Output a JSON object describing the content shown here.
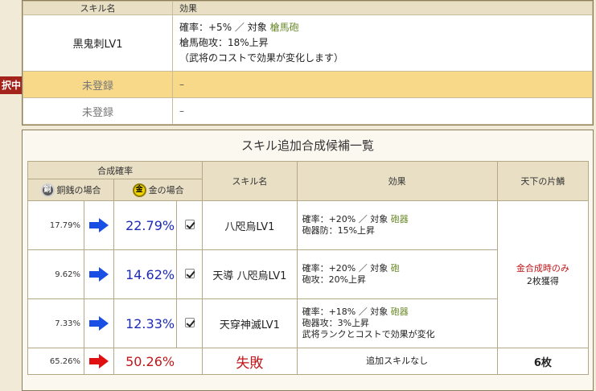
{
  "top": {
    "header_col1": "スキル名",
    "header_col2": "効果",
    "skill": {
      "name": "黒鬼刺LV1",
      "line1_prefix": "確率：+5% ／ 対象",
      "line1_target": "槍馬砲",
      "line2": "槍馬砲攻：18%上昇",
      "line3": "（武将のコストで効果が変化します）"
    },
    "rows": [
      {
        "name": "未登録",
        "effect": "–"
      },
      {
        "name": "未登録",
        "effect": "–"
      }
    ],
    "tag": "択中"
  },
  "panel_title": "スキル追加合成候補一覧",
  "table": {
    "h_rate": "合成確率",
    "h_copper": "銅銭の場合",
    "h_gold": "金の場合",
    "h_skill": "スキル名",
    "h_effect": "効果",
    "h_tenka": "天下の片鱗",
    "coin_copper": "銅",
    "coin_gold": "金",
    "rows": [
      {
        "copper": "17.79%",
        "gold": "22.79%",
        "skill": "八咫烏LV1",
        "eff1_prefix": "確率：+20% ／ 対象",
        "eff1_target": "砲器",
        "eff2": "砲器防：15%上昇",
        "eff3": ""
      },
      {
        "copper": "9.62%",
        "gold": "14.62%",
        "skill": "天導 八咫烏LV1",
        "eff1_prefix": "確率：+20% ／ 対象",
        "eff1_target": "砲",
        "eff2": "砲攻：20%上昇",
        "eff3": ""
      },
      {
        "copper": "7.33%",
        "gold": "12.33%",
        "skill": "天穿神滅LV1",
        "eff1_prefix": "確率：+18% ／ 対象",
        "eff1_target": "砲器",
        "eff2": "砲器攻：3%上昇",
        "eff3": "武将ランクとコストで効果が変化"
      }
    ],
    "fail": {
      "copper": "65.26%",
      "gold": "50.26%",
      "skill": "失敗",
      "effect": "追加スキルなし",
      "tenka": "6枚"
    },
    "tenka_line1": "金合成時のみ",
    "tenka_line2": "2枚獲得"
  },
  "colors": {
    "arrow_blue": "#1a4fe6",
    "arrow_red": "#e01010",
    "green": "#6a8a2a",
    "gold_blue": "#1d2ab8"
  }
}
